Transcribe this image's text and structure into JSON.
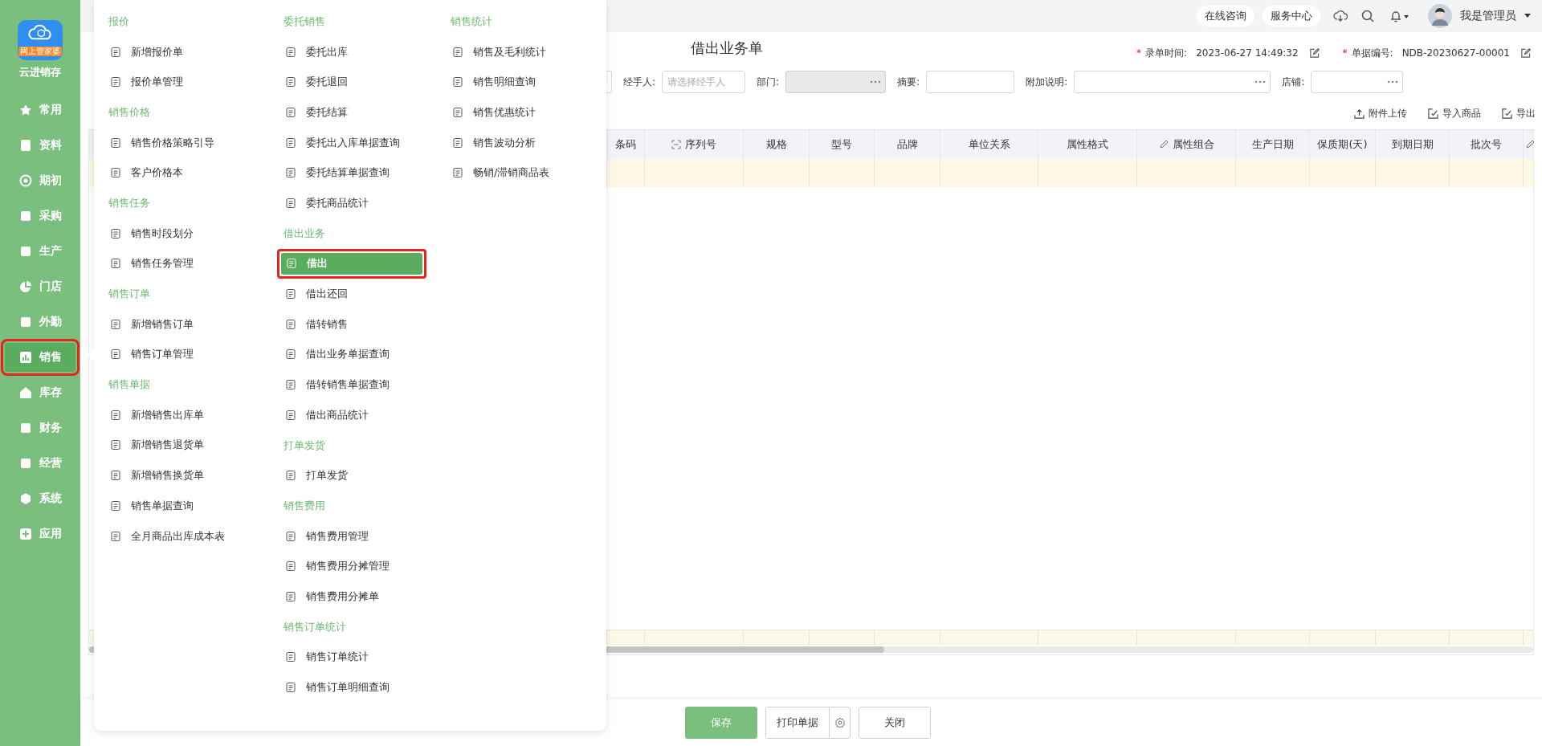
{
  "sidebar": {
    "logo": {
      "badge": "网上管家婆",
      "name": "云进销存"
    },
    "items": [
      {
        "label": "常用",
        "selected": false,
        "highlighted": false
      },
      {
        "label": "资料",
        "selected": false,
        "highlighted": false
      },
      {
        "label": "期初",
        "selected": false,
        "highlighted": false
      },
      {
        "label": "采购",
        "selected": false,
        "highlighted": false
      },
      {
        "label": "生产",
        "selected": false,
        "highlighted": false
      },
      {
        "label": "门店",
        "selected": false,
        "highlighted": false
      },
      {
        "label": "外勤",
        "selected": false,
        "highlighted": false
      },
      {
        "label": "销售",
        "selected": true,
        "highlighted": true
      },
      {
        "label": "库存",
        "selected": false,
        "highlighted": false
      },
      {
        "label": "财务",
        "selected": false,
        "highlighted": false
      },
      {
        "label": "经营",
        "selected": false,
        "highlighted": false
      },
      {
        "label": "系统",
        "selected": false,
        "highlighted": false
      },
      {
        "label": "应用",
        "selected": false,
        "highlighted": false
      }
    ]
  },
  "menu": {
    "columns": [
      [
        {
          "title": "报价",
          "items": [
            {
              "label": "新增报价单",
              "selected": false,
              "highlighted": false
            },
            {
              "label": "报价单管理",
              "selected": false,
              "highlighted": false
            }
          ]
        },
        {
          "title": "销售价格",
          "items": [
            {
              "label": "销售价格策略引导",
              "selected": false,
              "highlighted": false
            },
            {
              "label": "客户价格本",
              "selected": false,
              "highlighted": false
            }
          ]
        },
        {
          "title": "销售任务",
          "items": [
            {
              "label": "销售时段划分",
              "selected": false,
              "highlighted": false
            },
            {
              "label": "销售任务管理",
              "selected": false,
              "highlighted": false
            }
          ]
        },
        {
          "title": "销售订单",
          "items": [
            {
              "label": "新增销售订单",
              "selected": false,
              "highlighted": false
            },
            {
              "label": "销售订单管理",
              "selected": false,
              "highlighted": false
            }
          ]
        },
        {
          "title": "销售单据",
          "items": [
            {
              "label": "新增销售出库单",
              "selected": false,
              "highlighted": false
            },
            {
              "label": "新增销售退货单",
              "selected": false,
              "highlighted": false
            },
            {
              "label": "新增销售换货单",
              "selected": false,
              "highlighted": false
            },
            {
              "label": "销售单据查询",
              "selected": false,
              "highlighted": false
            },
            {
              "label": "全月商品出库成本表",
              "selected": false,
              "highlighted": false
            }
          ]
        }
      ],
      [
        {
          "title": "委托销售",
          "items": [
            {
              "label": "委托出库",
              "selected": false,
              "highlighted": false
            },
            {
              "label": "委托退回",
              "selected": false,
              "highlighted": false
            },
            {
              "label": "委托结算",
              "selected": false,
              "highlighted": false
            },
            {
              "label": "委托出入库单据查询",
              "selected": false,
              "highlighted": false
            },
            {
              "label": "委托结算单据查询",
              "selected": false,
              "highlighted": false
            },
            {
              "label": "委托商品统计",
              "selected": false,
              "highlighted": false
            }
          ]
        },
        {
          "title": "借出业务",
          "items": [
            {
              "label": "借出",
              "selected": true,
              "highlighted": true
            },
            {
              "label": "借出还回",
              "selected": false,
              "highlighted": false
            },
            {
              "label": "借转销售",
              "selected": false,
              "highlighted": false
            },
            {
              "label": "借出业务单据查询",
              "selected": false,
              "highlighted": false
            },
            {
              "label": "借转销售单据查询",
              "selected": false,
              "highlighted": false
            },
            {
              "label": "借出商品统计",
              "selected": false,
              "highlighted": false
            }
          ]
        },
        {
          "title": "打单发货",
          "items": [
            {
              "label": "打单发货",
              "selected": false,
              "highlighted": false
            }
          ]
        },
        {
          "title": "销售费用",
          "items": [
            {
              "label": "销售费用管理",
              "selected": false,
              "highlighted": false
            },
            {
              "label": "销售费用分摊管理",
              "selected": false,
              "highlighted": false
            },
            {
              "label": "销售费用分摊单",
              "selected": false,
              "highlighted": false
            }
          ]
        },
        {
          "title": "销售订单统计",
          "items": [
            {
              "label": "销售订单统计",
              "selected": false,
              "highlighted": false
            },
            {
              "label": "销售订单明细查询",
              "selected": false,
              "highlighted": false
            }
          ]
        }
      ],
      [
        {
          "title": "销售统计",
          "items": [
            {
              "label": "销售及毛利统计",
              "selected": false,
              "highlighted": false
            },
            {
              "label": "销售明细查询",
              "selected": false,
              "highlighted": false
            },
            {
              "label": "销售优惠统计",
              "selected": false,
              "highlighted": false
            },
            {
              "label": "销售波动分析",
              "selected": false,
              "highlighted": false
            },
            {
              "label": "畅销/滞销商品表",
              "selected": false,
              "highlighted": false
            }
          ]
        }
      ]
    ]
  },
  "topbar": {
    "buttons": [
      "在线咨询",
      "服务中心"
    ],
    "user": "我是管理员"
  },
  "document": {
    "title": "借出业务单",
    "meta": [
      {
        "mark": "*",
        "label": "录单时间:",
        "value": "2023-06-27 14:49:32"
      },
      {
        "mark": "*",
        "label": "单据编号:",
        "value": "NDB-20230627-00001"
      }
    ],
    "fields": [
      {
        "label": "经手人:",
        "placeholder": "请选择经手人",
        "kind": "text",
        "disabled": false
      },
      {
        "label": "部门:",
        "kind": "lookup",
        "disabled": true
      },
      {
        "label": "摘要:",
        "kind": "text",
        "disabled": false
      },
      {
        "label": "附加说明:",
        "kind": "lookup",
        "disabled": false
      },
      {
        "label": "店铺:",
        "kind": "lookup",
        "disabled": false
      }
    ],
    "toolbar": [
      "附件上传",
      "导入商品",
      "导出"
    ]
  },
  "table": {
    "columns": [
      {
        "label": "条码",
        "kind": "plain"
      },
      {
        "label": "序列号",
        "kind": "scan"
      },
      {
        "label": "规格",
        "kind": "plain"
      },
      {
        "label": "型号",
        "kind": "plain"
      },
      {
        "label": "品牌",
        "kind": "plain"
      },
      {
        "label": "单位关系",
        "kind": "plain"
      },
      {
        "label": "属性格式",
        "kind": "plain"
      },
      {
        "label": "属性组合",
        "kind": "edit"
      },
      {
        "label": "生产日期",
        "kind": "plain"
      },
      {
        "label": "保质期(天)",
        "kind": "plain"
      },
      {
        "label": "到期日期",
        "kind": "plain"
      },
      {
        "label": "批次号",
        "kind": "plain"
      },
      {
        "kind": "edit"
      }
    ]
  },
  "footer": {
    "buttons": [
      {
        "label": "保存",
        "kind": "primary"
      },
      {
        "label": "打印单据",
        "kind": "split"
      },
      {
        "label": "关闭",
        "kind": "plain"
      }
    ]
  }
}
